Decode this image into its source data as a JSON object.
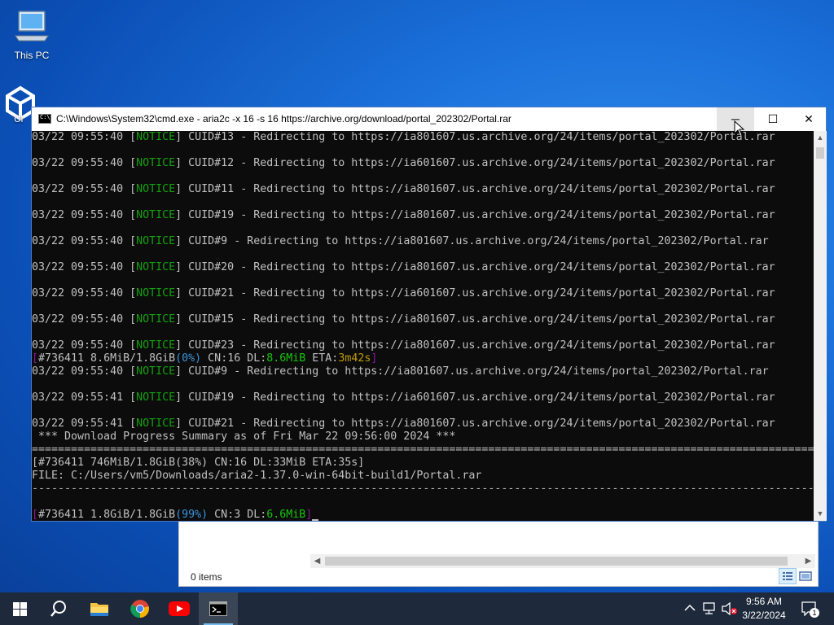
{
  "desktop": {
    "icons": [
      {
        "label": "This PC",
        "icon": "this-pc-icon"
      },
      {
        "label": "Ur",
        "icon": "unity-icon"
      }
    ]
  },
  "explorer": {
    "status": "0 items"
  },
  "cmd": {
    "title": "C:\\Windows\\System32\\cmd.exe - aria2c  -x 16 -s 16 https://archive.org/download/portal_202302/Portal.rar",
    "buttons": {
      "minimize": "─",
      "maximize": "☐",
      "close": "✕"
    },
    "lines": [
      {
        "parts": [
          {
            "t": "03/22 09:55:40 ["
          },
          {
            "t": "NOTICE",
            "c": "g"
          },
          {
            "t": "] CUID#13 - Redirecting to https://ia801607.us.archive.org/24/items/portal_202302/Portal.rar"
          }
        ]
      },
      {
        "parts": [
          {
            "t": ""
          }
        ]
      },
      {
        "parts": [
          {
            "t": "03/22 09:55:40 ["
          },
          {
            "t": "NOTICE",
            "c": "g"
          },
          {
            "t": "] CUID#12 - Redirecting to https://ia601607.us.archive.org/24/items/portal_202302/Portal.rar"
          }
        ]
      },
      {
        "parts": [
          {
            "t": ""
          }
        ]
      },
      {
        "parts": [
          {
            "t": "03/22 09:55:40 ["
          },
          {
            "t": "NOTICE",
            "c": "g"
          },
          {
            "t": "] CUID#11 - Redirecting to https://ia801607.us.archive.org/24/items/portal_202302/Portal.rar"
          }
        ]
      },
      {
        "parts": [
          {
            "t": ""
          }
        ]
      },
      {
        "parts": [
          {
            "t": "03/22 09:55:40 ["
          },
          {
            "t": "NOTICE",
            "c": "g"
          },
          {
            "t": "] CUID#19 - Redirecting to https://ia801607.us.archive.org/24/items/portal_202302/Portal.rar"
          }
        ]
      },
      {
        "parts": [
          {
            "t": ""
          }
        ]
      },
      {
        "parts": [
          {
            "t": "03/22 09:55:40 ["
          },
          {
            "t": "NOTICE",
            "c": "g"
          },
          {
            "t": "] CUID#9 - Redirecting to https://ia801607.us.archive.org/24/items/portal_202302/Portal.rar"
          }
        ]
      },
      {
        "parts": [
          {
            "t": ""
          }
        ]
      },
      {
        "parts": [
          {
            "t": "03/22 09:55:40 ["
          },
          {
            "t": "NOTICE",
            "c": "g"
          },
          {
            "t": "] CUID#20 - Redirecting to https://ia801607.us.archive.org/24/items/portal_202302/Portal.rar"
          }
        ]
      },
      {
        "parts": [
          {
            "t": ""
          }
        ]
      },
      {
        "parts": [
          {
            "t": "03/22 09:55:40 ["
          },
          {
            "t": "NOTICE",
            "c": "g"
          },
          {
            "t": "] CUID#21 - Redirecting to https://ia601607.us.archive.org/24/items/portal_202302/Portal.rar"
          }
        ]
      },
      {
        "parts": [
          {
            "t": ""
          }
        ]
      },
      {
        "parts": [
          {
            "t": "03/22 09:55:40 ["
          },
          {
            "t": "NOTICE",
            "c": "g"
          },
          {
            "t": "] CUID#15 - Redirecting to https://ia801607.us.archive.org/24/items/portal_202302/Portal.rar"
          }
        ]
      },
      {
        "parts": [
          {
            "t": ""
          }
        ]
      },
      {
        "parts": [
          {
            "t": "03/22 09:55:40 ["
          },
          {
            "t": "NOTICE",
            "c": "g"
          },
          {
            "t": "] CUID#23 - Redirecting to https://ia801607.us.archive.org/24/items/portal_202302/Portal.rar"
          }
        ]
      },
      {
        "parts": [
          {
            "t": "[",
            "c": "m"
          },
          {
            "t": "#736411 8.6MiB/1.8GiB"
          },
          {
            "t": "(0%)",
            "c": "c"
          },
          {
            "t": " CN:16 DL:"
          },
          {
            "t": "8.6MiB",
            "c": "gl"
          },
          {
            "t": " ETA:"
          },
          {
            "t": "3m42s",
            "c": "y"
          },
          {
            "t": "]",
            "c": "m"
          }
        ]
      },
      {
        "parts": [
          {
            "t": "03/22 09:55:40 ["
          },
          {
            "t": "NOTICE",
            "c": "g"
          },
          {
            "t": "] CUID#9 - Redirecting to https://ia801607.us.archive.org/24/items/portal_202302/Portal.rar"
          }
        ]
      },
      {
        "parts": [
          {
            "t": ""
          }
        ]
      },
      {
        "parts": [
          {
            "t": "03/22 09:55:41 ["
          },
          {
            "t": "NOTICE",
            "c": "g"
          },
          {
            "t": "] CUID#19 - Redirecting to https://ia601607.us.archive.org/24/items/portal_202302/Portal.rar"
          }
        ]
      },
      {
        "parts": [
          {
            "t": ""
          }
        ]
      },
      {
        "parts": [
          {
            "t": "03/22 09:55:41 ["
          },
          {
            "t": "NOTICE",
            "c": "g"
          },
          {
            "t": "] CUID#21 - Redirecting to https://ia801607.us.archive.org/24/items/portal_202302/Portal.rar"
          }
        ]
      },
      {
        "parts": [
          {
            "t": " *** Download Progress Summary as of Fri Mar 22 09:56:00 2024 ***"
          }
        ]
      },
      {
        "parts": [
          {
            "t": "=============================================================================================================================="
          }
        ]
      },
      {
        "parts": [
          {
            "t": "[#736411 746MiB/1.8GiB(38%) CN:16 DL:33MiB ETA:35s]"
          }
        ]
      },
      {
        "parts": [
          {
            "t": "FILE: C:/Users/vm5/Downloads/aria2-1.37.0-win-64bit-build1/Portal.rar"
          }
        ]
      },
      {
        "parts": [
          {
            "t": "------------------------------------------------------------------------------------------------------------------------------"
          }
        ]
      },
      {
        "parts": [
          {
            "t": ""
          }
        ]
      },
      {
        "parts": [
          {
            "t": "[",
            "c": "m"
          },
          {
            "t": "#736411 1.8GiB/1.8GiB"
          },
          {
            "t": "(99%)",
            "c": "c"
          },
          {
            "t": " CN:3 DL:"
          },
          {
            "t": "6.6MiB",
            "c": "gl"
          },
          {
            "t": "]",
            "c": "m"
          }
        ],
        "cursor": true
      }
    ]
  },
  "taskbar": {
    "items": [
      {
        "name": "start-button",
        "icon": "windows-logo-icon"
      },
      {
        "name": "search-button",
        "icon": "search-icon"
      },
      {
        "name": "file-explorer-button",
        "icon": "folder-icon"
      },
      {
        "name": "chrome-button",
        "icon": "chrome-icon"
      },
      {
        "name": "youtube-button",
        "icon": "youtube-icon"
      },
      {
        "name": "cmd-taskbar-button",
        "icon": "cmd-icon",
        "active": true
      }
    ],
    "tray": {
      "time": "9:56 AM",
      "date": "3/22/2024",
      "notifications": "1"
    }
  },
  "colors": {
    "notice": "#13a10e",
    "bracket": "#881798",
    "percent": "#3a96dd",
    "speed": "#16c60c",
    "eta": "#c19c00",
    "accent": "#76b9ed"
  }
}
